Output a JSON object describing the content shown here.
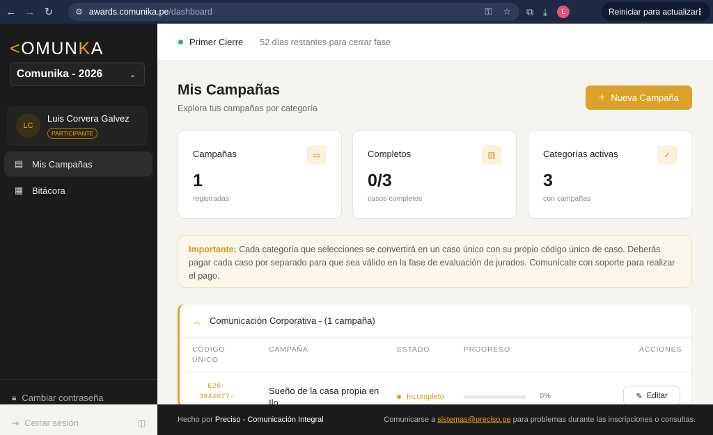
{
  "browser": {
    "url_host": "awards.comunika.pe",
    "url_path": "/dashboard",
    "profile_initial": "L",
    "update_label": "Reiniciar para actualizar"
  },
  "sidebar": {
    "logo_accent_left": "<",
    "logo_mid": "OMUN",
    "logo_accent_right": "K",
    "logo_end": "A",
    "season": "Comunika - 2026",
    "user": {
      "initials": "LC",
      "name": "Luis Corvera Galvez",
      "role": "PARTICIPANTE"
    },
    "items": [
      {
        "label": "Mis Campañas",
        "icon": "clipboard-icon"
      },
      {
        "label": "Bitácora",
        "icon": "log-icon"
      }
    ],
    "change_password": "Cambiar contraseña",
    "logout": "Cerrar sesión"
  },
  "topbar": {
    "phase": "Primer Cierre",
    "remaining": "52 días restantes para cerrar fase"
  },
  "main": {
    "title": "Mis Campañas",
    "subtitle": "Explora tus campañas por categoría",
    "new_button": "Nueva Campaña",
    "stats": [
      {
        "label": "Campañas",
        "value": "1",
        "caption": "registradas",
        "icon": "folder-icon"
      },
      {
        "label": "Completos",
        "value": "0/3",
        "caption": "casos completos",
        "icon": "bar-chart-icon"
      },
      {
        "label": "Categorías activas",
        "value": "3",
        "caption": "con campañas",
        "icon": "check-circle-icon"
      }
    ],
    "notice_label": "Importante:",
    "notice_text": " Cada categoría que selecciones se convertirá en un caso único con su propio código único de caso. Deberás pagar cada caso por separado para que sea válido en la fase de evaluación de jurados. Comunícate con soporte para realizar el pago."
  },
  "category": {
    "title": "Comunicación Corporativa - (1 campaña)",
    "columns": [
      "CÓDIGO ÚNICO",
      "CAMPAÑA",
      "ESTADO",
      "PROGRESO",
      "ACCIONES"
    ],
    "rows": [
      {
        "code": "E26–3844677–",
        "campaign": "Sueño de la casa propia en Ilo",
        "status": "Incompleto",
        "progress_text": "0%",
        "progress": 0,
        "action": "Editar"
      }
    ]
  },
  "footer": {
    "made_by_prefix": "Hecho por ",
    "made_by_name": "Preciso - Comunicación Integral",
    "contact_prefix": "Comunicarse a ",
    "contact_email": "sistemas@preciso.pe",
    "contact_suffix": " para problemas durante las inscripciones o consultas."
  },
  "colors": {
    "accent": "#dca12a",
    "sidebar_bg": "#1b1b1b",
    "status_green": "#22b573"
  }
}
